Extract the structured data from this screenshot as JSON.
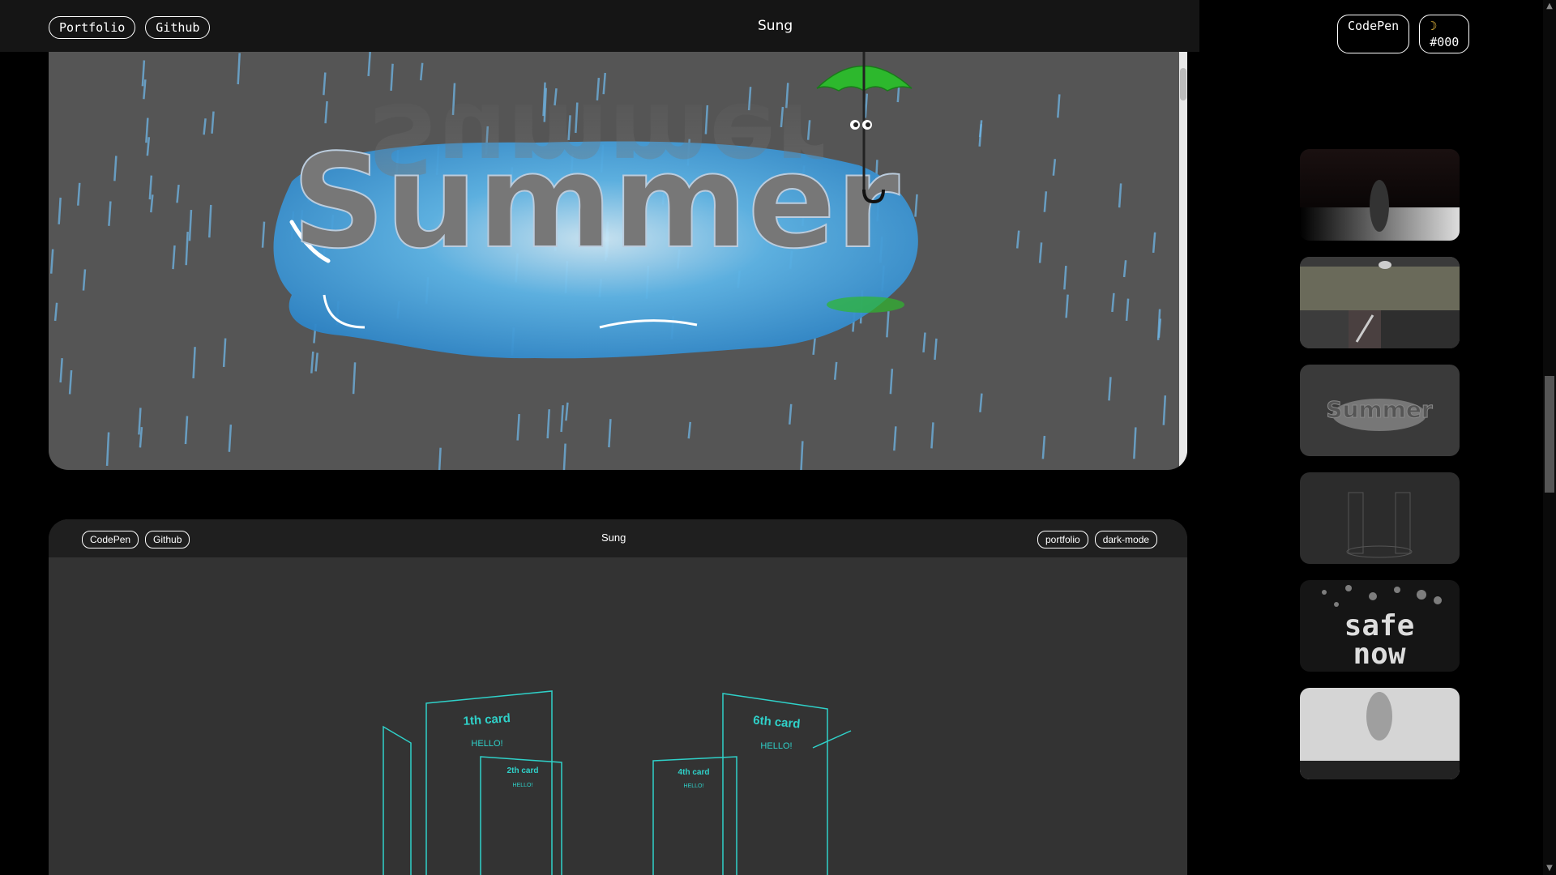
{
  "topbar": {
    "left_buttons": [
      "Portfolio",
      "Github"
    ],
    "title": "Sung",
    "codepen_label": "CodePen",
    "theme_label": "#000",
    "theme_icon": "moon-icon"
  },
  "card1": {
    "word": "Summer",
    "reflection": "Summer"
  },
  "card2": {
    "left_buttons": [
      "CodePen",
      "Github"
    ],
    "title": "Sung",
    "right_buttons": [
      "portfolio",
      "dark-mode"
    ],
    "cards": {
      "c1_title": "1th card",
      "c1_sub": "HELLO!",
      "c2_title": "2th card",
      "c2_sub": "HELLO!",
      "c4_title": "4th card",
      "c4_sub": "HELLO!",
      "c6_title": "6th card",
      "c6_sub": "HELLO!"
    }
  },
  "thumbnails": {
    "t3_word": "Summer",
    "t5_line1": "safe",
    "t5_line2": "now"
  },
  "colors": {
    "accent_cyan": "#2fd1c9",
    "puddle_blue": "#3a9fdc",
    "umbrella_green": "#2db82d"
  }
}
